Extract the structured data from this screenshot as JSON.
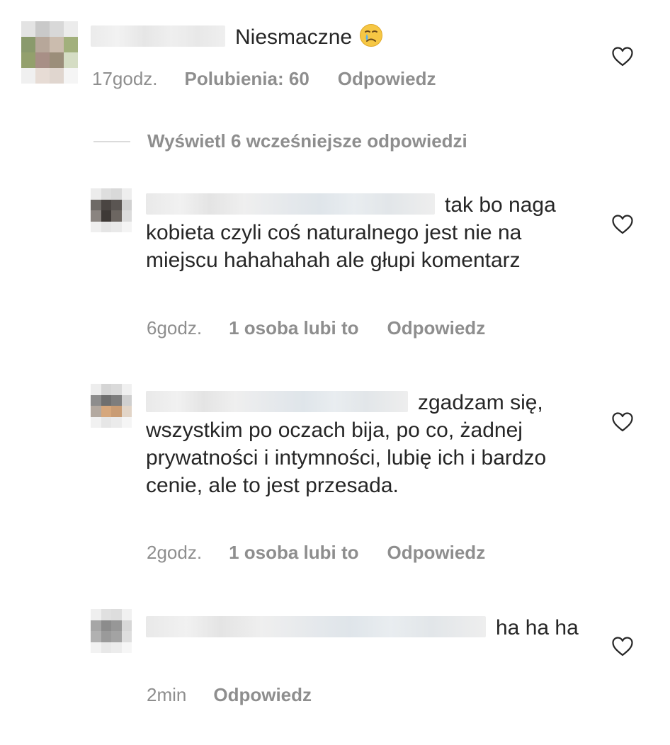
{
  "comments": [
    {
      "text": "Niesmaczne",
      "emoji": "crying-face",
      "time": "17godz.",
      "likes": "Polubienia: 60",
      "reply": "Odpowiedz"
    },
    {
      "text": "tak bo naga kobieta czyli coś naturalnego jest nie na miejscu hahahahah ale głupi komentarz",
      "time": "6godz.",
      "likes": "1 osoba lubi to",
      "reply": "Odpowiedz"
    },
    {
      "text": "zgadzam się, wszystkim po oczach bija, po co, żadnej prywatności i intymności, lubię ich i bardzo cenie, ale to jest przesada.",
      "time": "2godz.",
      "likes": "1 osoba lubi to",
      "reply": "Odpowiedz"
    },
    {
      "text": "ha ha ha",
      "time": "2min",
      "reply": "Odpowiedz"
    }
  ],
  "view_replies": "Wyświetl 6 wcześniejsze odpowiedzi",
  "icons": {
    "like": "heart-outline-icon"
  },
  "colors": {
    "text": "#262626",
    "meta": "#8e8e8e",
    "divider": "#dbdbdb"
  }
}
